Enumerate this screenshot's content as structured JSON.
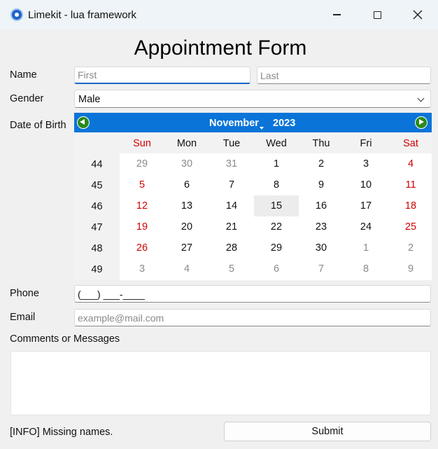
{
  "window": {
    "title": "Limekit - lua framework"
  },
  "form": {
    "title": "Appointment Form"
  },
  "name": {
    "label": "Name",
    "first_placeholder": "First",
    "last_placeholder": "Last"
  },
  "gender": {
    "label": "Gender",
    "value": "Male"
  },
  "dob": {
    "label": "Date of Birth",
    "month": "November",
    "year": "2023",
    "weekdays": [
      "Sun",
      "Mon",
      "Tue",
      "Wed",
      "Thu",
      "Fri",
      "Sat"
    ],
    "weeks": [
      {
        "num": "44",
        "days": [
          "29",
          "30",
          "31",
          "1",
          "2",
          "3",
          "4"
        ]
      },
      {
        "num": "45",
        "days": [
          "5",
          "6",
          "7",
          "8",
          "9",
          "10",
          "11"
        ]
      },
      {
        "num": "46",
        "days": [
          "12",
          "13",
          "14",
          "15",
          "16",
          "17",
          "18"
        ]
      },
      {
        "num": "47",
        "days": [
          "19",
          "20",
          "21",
          "22",
          "23",
          "24",
          "25"
        ]
      },
      {
        "num": "48",
        "days": [
          "26",
          "27",
          "28",
          "29",
          "30",
          "1",
          "2"
        ]
      },
      {
        "num": "49",
        "days": [
          "3",
          "4",
          "5",
          "6",
          "7",
          "8",
          "9"
        ]
      }
    ],
    "selected_day": "15"
  },
  "phone": {
    "label": "Phone",
    "value": "(___) ___-____"
  },
  "email": {
    "label": "Email",
    "placeholder": "example@mail.com"
  },
  "comments": {
    "label": "Comments or Messages"
  },
  "status": "[INFO] Missing names.",
  "submit_label": "Submit",
  "colors": {
    "accent": "#0a74d8",
    "weekend": "#d00000",
    "nav_button": "#2b8a1c"
  }
}
